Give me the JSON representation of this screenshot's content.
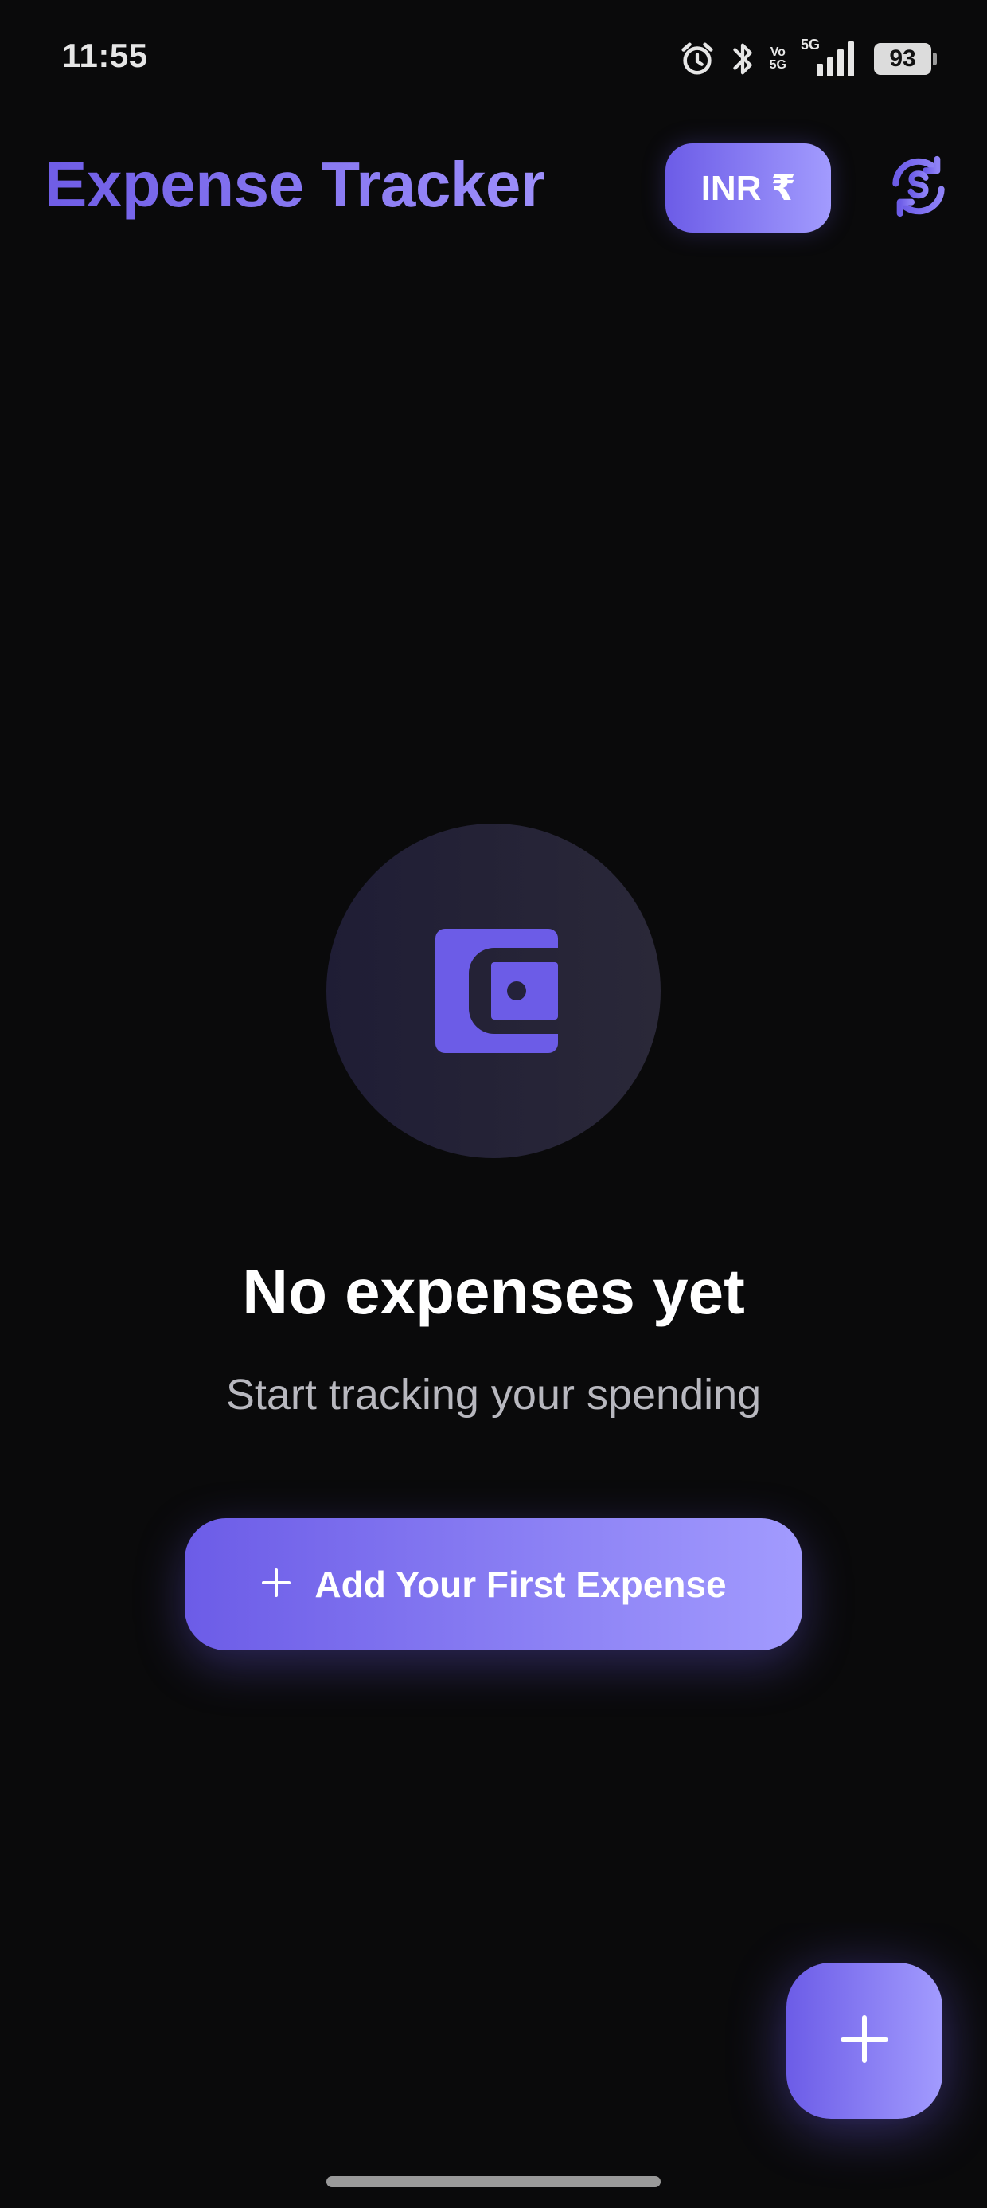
{
  "status_bar": {
    "time": "11:55",
    "volte_top": "Vo",
    "volte_bottom": "5G",
    "network": "5G",
    "battery": "93",
    "icons": [
      "alarm-icon",
      "bluetooth-icon",
      "volte-icon",
      "signal-icon",
      "battery-icon"
    ]
  },
  "header": {
    "title": "Expense Tracker",
    "currency_label": "INR ₹",
    "refresh_icon": "currency-refresh-icon"
  },
  "empty_state": {
    "icon": "wallet-icon",
    "title": "No expenses yet",
    "subtitle": "Start tracking your spending",
    "button_label": "Add Your First Expense"
  },
  "fab": {
    "icon": "plus-icon"
  },
  "colors": {
    "background": "#0a0a0b",
    "accent_start": "#6c5ce7",
    "accent_end": "#a29bfe",
    "subtitle": "#b8b8bf"
  }
}
